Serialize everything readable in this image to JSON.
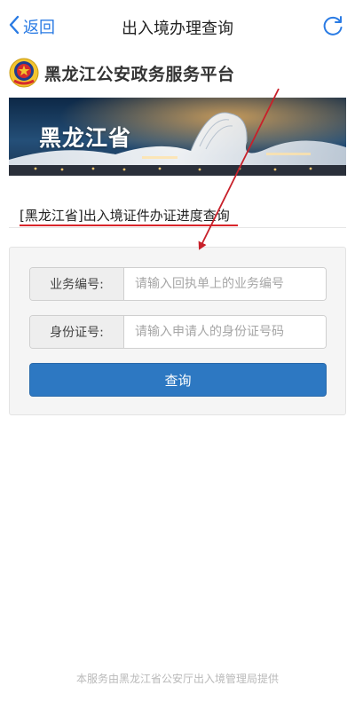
{
  "nav": {
    "back_label": "返回",
    "title": "出入境办理查询",
    "accent_color": "#2a7be4"
  },
  "brand": {
    "name": "黑龙江公安政务服务平台"
  },
  "banner": {
    "text": "黑龙江省"
  },
  "section": {
    "title": "[黑龙江省]出入境证件办证进度查询",
    "underline_color": "#d9262b"
  },
  "form": {
    "business_no": {
      "label": "业务编号:",
      "value": "",
      "placeholder": "请输入回执单上的业务编号"
    },
    "id_no": {
      "label": "身份证号:",
      "value": "",
      "placeholder": "请输入申请人的身份证号码"
    },
    "submit_label": "查询",
    "button_color": "#2d78c2"
  },
  "footer": {
    "text": "本服务由黑龙江省公安厅出入境管理局提供"
  },
  "icons": [
    "chevron-left-icon",
    "refresh-icon",
    "police-emblem-icon"
  ]
}
